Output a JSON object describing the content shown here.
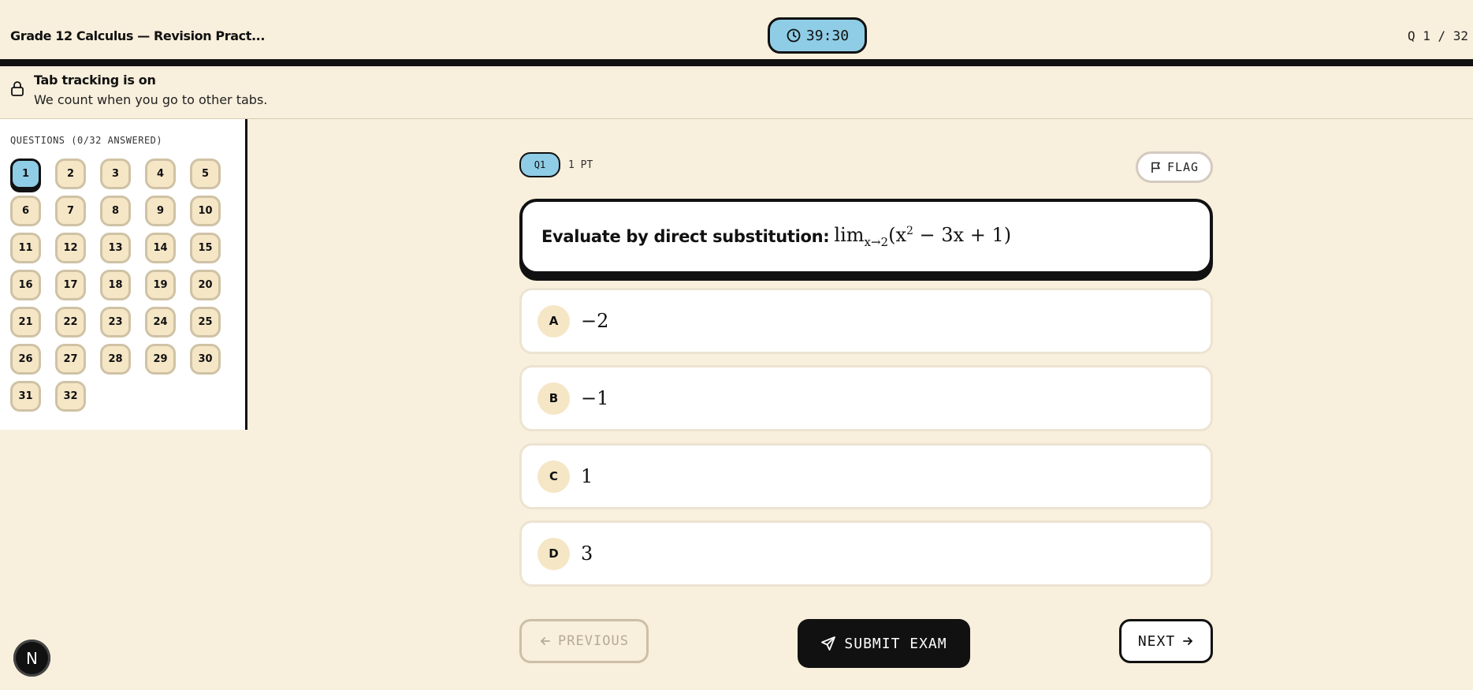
{
  "header": {
    "exam_title": "Grade 12 Calculus — Revision Pract...",
    "timer": "39:30",
    "question_counter": "Q 1 / 32"
  },
  "banner": {
    "title": "Tab tracking is on",
    "subtitle": "We count when you go to other tabs."
  },
  "sidebar": {
    "title": "QUESTIONS (0/32 ANSWERED)",
    "questions": [
      "1",
      "2",
      "3",
      "4",
      "5",
      "6",
      "7",
      "8",
      "9",
      "10",
      "11",
      "12",
      "13",
      "14",
      "15",
      "16",
      "17",
      "18",
      "19",
      "20",
      "21",
      "22",
      "23",
      "24",
      "25",
      "26",
      "27",
      "28",
      "29",
      "30",
      "31",
      "32"
    ],
    "current": "1"
  },
  "question": {
    "number_label": "Q1",
    "points": "1 PT",
    "flag_label": "FLAG",
    "prompt": "Evaluate by direct substitution:",
    "math_lim": "lim",
    "math_sub": "x→2",
    "math_open": "(x",
    "math_sup": "2",
    "math_rest": " − 3x + 1)",
    "options": [
      {
        "letter": "A",
        "value": "−2"
      },
      {
        "letter": "B",
        "value": "−1"
      },
      {
        "letter": "C",
        "value": "1"
      },
      {
        "letter": "D",
        "value": "3"
      }
    ]
  },
  "nav": {
    "previous_label": "PREVIOUS",
    "submit_label": "SUBMIT EXAM",
    "next_label": "NEXT"
  },
  "badge": {
    "letter": "N"
  },
  "colors": {
    "background": "#f8efdc",
    "accent": "#8fcde6",
    "chip": "#f5e6c6",
    "ink": "#111111"
  }
}
